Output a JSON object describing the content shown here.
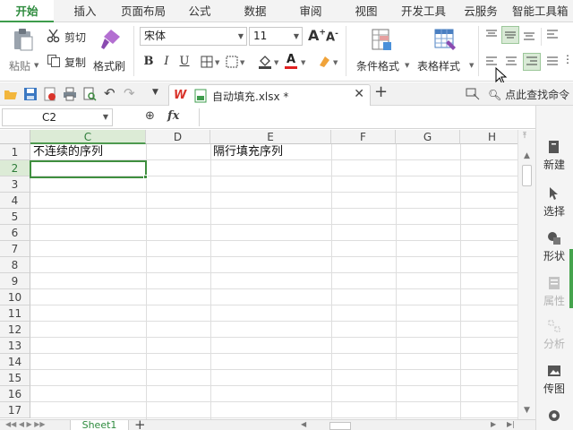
{
  "menu": {
    "tabs": [
      {
        "label": "开始",
        "active": true
      },
      {
        "label": "插入"
      },
      {
        "label": "页面布局"
      },
      {
        "label": "公式"
      },
      {
        "label": "数据"
      },
      {
        "label": "审阅"
      },
      {
        "label": "视图"
      },
      {
        "label": "开发工具"
      },
      {
        "label": "云服务"
      },
      {
        "label": "智能工具箱"
      }
    ]
  },
  "ribbon": {
    "paste": "粘贴",
    "cut": "剪切",
    "copy": "复制",
    "format_painter": "格式刷",
    "font_name": "宋体",
    "font_size": "11",
    "bold": "B",
    "italic": "I",
    "underline": "U",
    "font_color_glyph": "A",
    "grow_font": "A",
    "shrink_font": "A",
    "conditional_format": "条件格式",
    "table_style": "表格样式",
    "accent_green": "#3e9c4c",
    "font_color_red": "#e02020"
  },
  "quickbar": {
    "document_tab": "自动填充.xlsx *",
    "find_command": "点此查找命令"
  },
  "formula_bar": {
    "name_box": "C2",
    "fx": "fx"
  },
  "sheet": {
    "columns": [
      "C",
      "D",
      "E",
      "F",
      "G",
      "H"
    ],
    "selected_column": "C",
    "rows": [
      "1",
      "2",
      "3",
      "4",
      "5",
      "6",
      "7",
      "8",
      "9",
      "10",
      "11",
      "12",
      "13",
      "14",
      "15",
      "16",
      "17"
    ],
    "selected_row": "2",
    "cells": {
      "C1": "不连续的序列",
      "E1": "隔行填充序列"
    },
    "active_cell": "C2",
    "sheet_tab": "Sheet1"
  },
  "side_panel": {
    "items": [
      {
        "label": "新建",
        "icon": "new-icon",
        "enabled": true
      },
      {
        "label": "选择",
        "icon": "select-cursor-icon",
        "enabled": true
      },
      {
        "label": "形状",
        "icon": "shapes-icon",
        "enabled": true
      },
      {
        "label": "属性",
        "icon": "properties-icon",
        "enabled": false
      },
      {
        "label": "分析",
        "icon": "analysis-icon",
        "enabled": false
      },
      {
        "label": "传图",
        "icon": "upload-image-icon",
        "enabled": true
      }
    ]
  }
}
